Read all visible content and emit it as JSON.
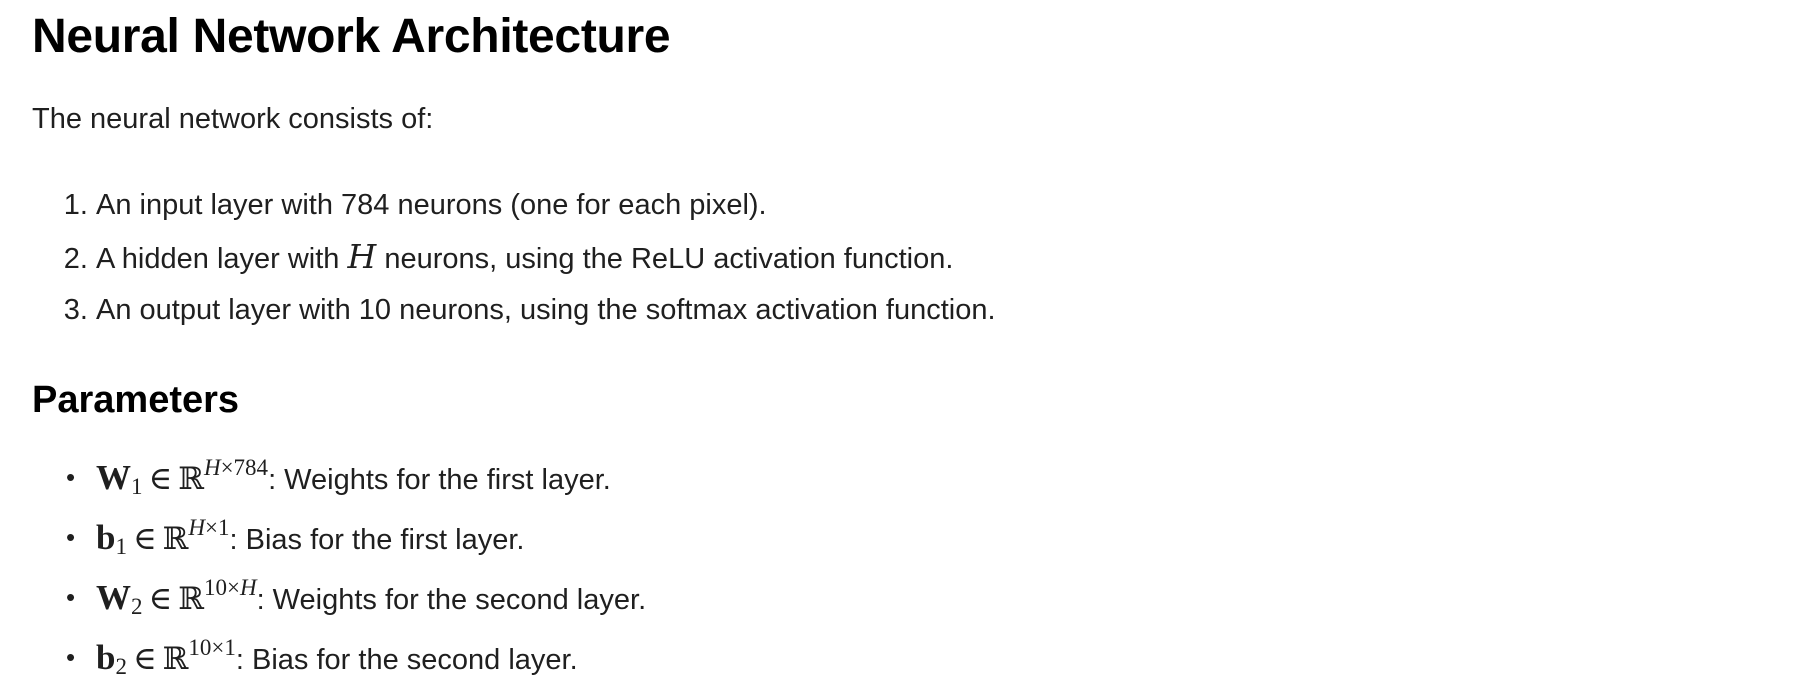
{
  "doc": {
    "title": "Neural Network Architecture",
    "intro": "The neural network consists of:",
    "layers": [
      {
        "text": "An input layer with 784 neurons (one for each pixel)."
      },
      {
        "before": "A hidden layer with ",
        "var": "H",
        "after": " neurons, using the ReLU activation function."
      },
      {
        "text": "An output layer with 10 neurons, using the softmax activation function."
      }
    ],
    "parameters_heading": "Parameters",
    "parameters": [
      {
        "bullet": "•",
        "symbol": "W",
        "sub": "1",
        "elem": "∈",
        "reals": "ℝ",
        "sup_a": "H",
        "sup_b": "×784",
        "desc": ": Weights for the first layer."
      },
      {
        "bullet": "•",
        "symbol": "b",
        "sub": "1",
        "elem": "∈",
        "reals": "ℝ",
        "sup_a": "H",
        "sup_b": "×1",
        "desc": ": Bias for the first layer."
      },
      {
        "bullet": "•",
        "symbol": "W",
        "sub": "2",
        "elem": "∈",
        "reals": "ℝ",
        "sup_a": "10×",
        "sup_b": "H",
        "desc": ": Weights for the second layer."
      },
      {
        "bullet": "•",
        "symbol": "b",
        "sub": "2",
        "elem": "∈",
        "reals": "ℝ",
        "sup_a": "10×1",
        "sup_b": "",
        "desc": ": Bias for the second layer."
      }
    ]
  }
}
